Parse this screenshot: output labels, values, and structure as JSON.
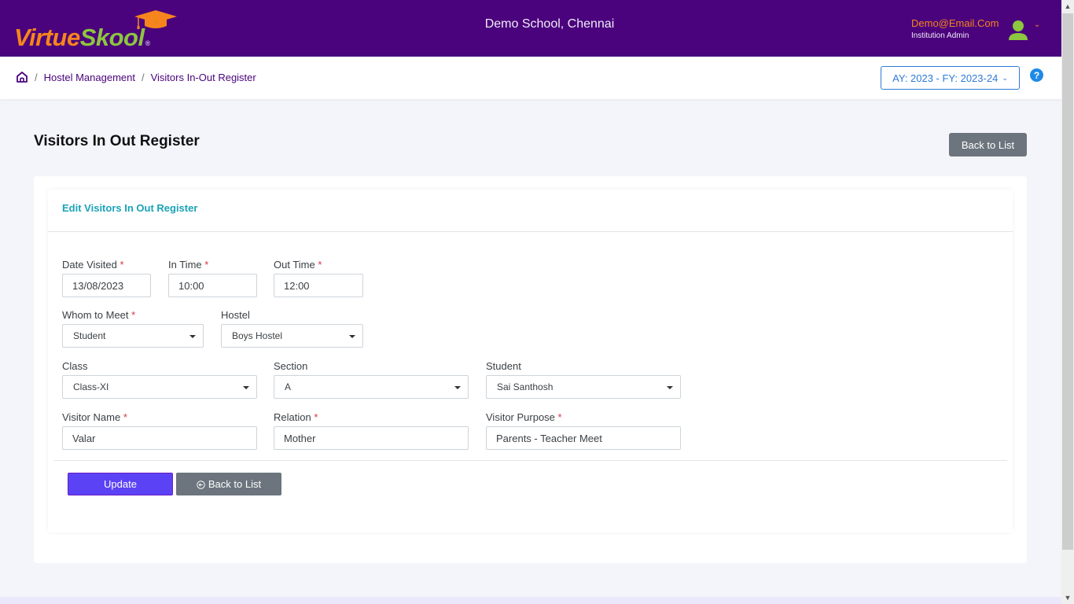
{
  "header": {
    "logo": {
      "part1": "Virtue",
      "part2": "Skool",
      "reg": "®"
    },
    "school_name": "Demo School, Chennai",
    "user": {
      "email": "Demo@Email.Com",
      "role": "Institution Admin"
    },
    "colors": {
      "brand": "#4a037c",
      "orange": "#f7851d",
      "green": "#8dc63f"
    }
  },
  "breadcrumb": {
    "items": [
      "Hostel Management",
      "Visitors In-Out Register"
    ],
    "separator": "/"
  },
  "academic_year": {
    "label": "AY: 2023 - FY: 2023-24",
    "chevron": "⌄"
  },
  "help": {
    "label": "?"
  },
  "page": {
    "title": "Visitors In Out Register",
    "back_button": "Back to List"
  },
  "form": {
    "title": "Edit Visitors In Out Register",
    "fields": {
      "date_visited": {
        "label": "Date Visited",
        "required": "*",
        "value": "13/08/2023"
      },
      "in_time": {
        "label": "In Time",
        "required": "*",
        "value": "10:00"
      },
      "out_time": {
        "label": "Out Time",
        "required": "*",
        "value": "12:00"
      },
      "whom_to_meet": {
        "label": "Whom to Meet",
        "required": "*",
        "value": "Student"
      },
      "hostel": {
        "label": "Hostel",
        "value": "Boys Hostel"
      },
      "class": {
        "label": "Class",
        "value": "Class-XI"
      },
      "section": {
        "label": "Section",
        "value": "A"
      },
      "student": {
        "label": "Student",
        "value": "Sai Santhosh"
      },
      "visitor_name": {
        "label": "Visitor Name",
        "required": "*",
        "value": "Valar"
      },
      "relation": {
        "label": "Relation",
        "required": "*",
        "value": "Mother"
      },
      "visitor_purpose": {
        "label": "Visitor Purpose",
        "required": "*",
        "value": "Parents - Teacher Meet"
      }
    },
    "buttons": {
      "update": "Update",
      "back": "Back to List"
    }
  },
  "scrollbar": {
    "up": "▲",
    "down": "▼"
  }
}
